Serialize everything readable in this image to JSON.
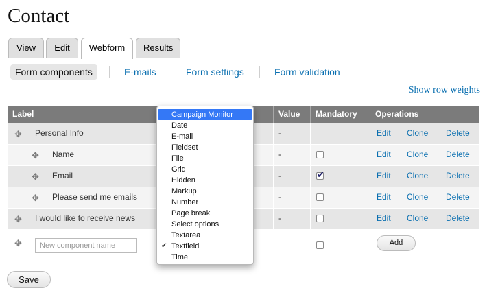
{
  "page_title": "Contact",
  "tabs": [
    {
      "label": "View",
      "active": false
    },
    {
      "label": "Edit",
      "active": false
    },
    {
      "label": "Webform",
      "active": true
    },
    {
      "label": "Results",
      "active": false
    }
  ],
  "subtabs": [
    {
      "label": "Form components",
      "active": true
    },
    {
      "label": "E-mails",
      "active": false
    },
    {
      "label": "Form settings",
      "active": false
    },
    {
      "label": "Form validation",
      "active": false
    }
  ],
  "row_weights_link": "Show row weights",
  "table": {
    "headers": [
      "Label",
      "Value",
      "Mandatory",
      "Operations"
    ],
    "rows": [
      {
        "label": "Personal Info",
        "value": "-",
        "mandatory": null,
        "ops": [
          "Edit",
          "Clone",
          "Delete"
        ]
      },
      {
        "label": "Name",
        "value": "-",
        "mandatory": false,
        "ops": [
          "Edit",
          "Clone",
          "Delete"
        ]
      },
      {
        "label": "Email",
        "value": "-",
        "mandatory": true,
        "ops": [
          "Edit",
          "Clone",
          "Delete"
        ]
      },
      {
        "label": "Please send me emails",
        "value": "-",
        "mandatory": false,
        "ops": [
          "Edit",
          "Clone",
          "Delete"
        ]
      },
      {
        "label": "I would like to receive news",
        "value": "-",
        "mandatory": false,
        "ops": [
          "Edit",
          "Clone",
          "Delete"
        ]
      }
    ]
  },
  "add_row": {
    "name_placeholder": "New component name",
    "add_label": "Add"
  },
  "type_menu": {
    "items": [
      "Campaign Monitor",
      "Date",
      "E-mail",
      "Fieldset",
      "File",
      "Grid",
      "Hidden",
      "Markup",
      "Number",
      "Page break",
      "Select options",
      "Textarea",
      "Textfield",
      "Time"
    ],
    "highlighted": "Campaign Monitor",
    "checked": "Textfield"
  },
  "save_label": "Save",
  "colors": {
    "link": "#0a6fb0",
    "header_bg": "#7b7b7b",
    "highlight": "#3478f6"
  }
}
